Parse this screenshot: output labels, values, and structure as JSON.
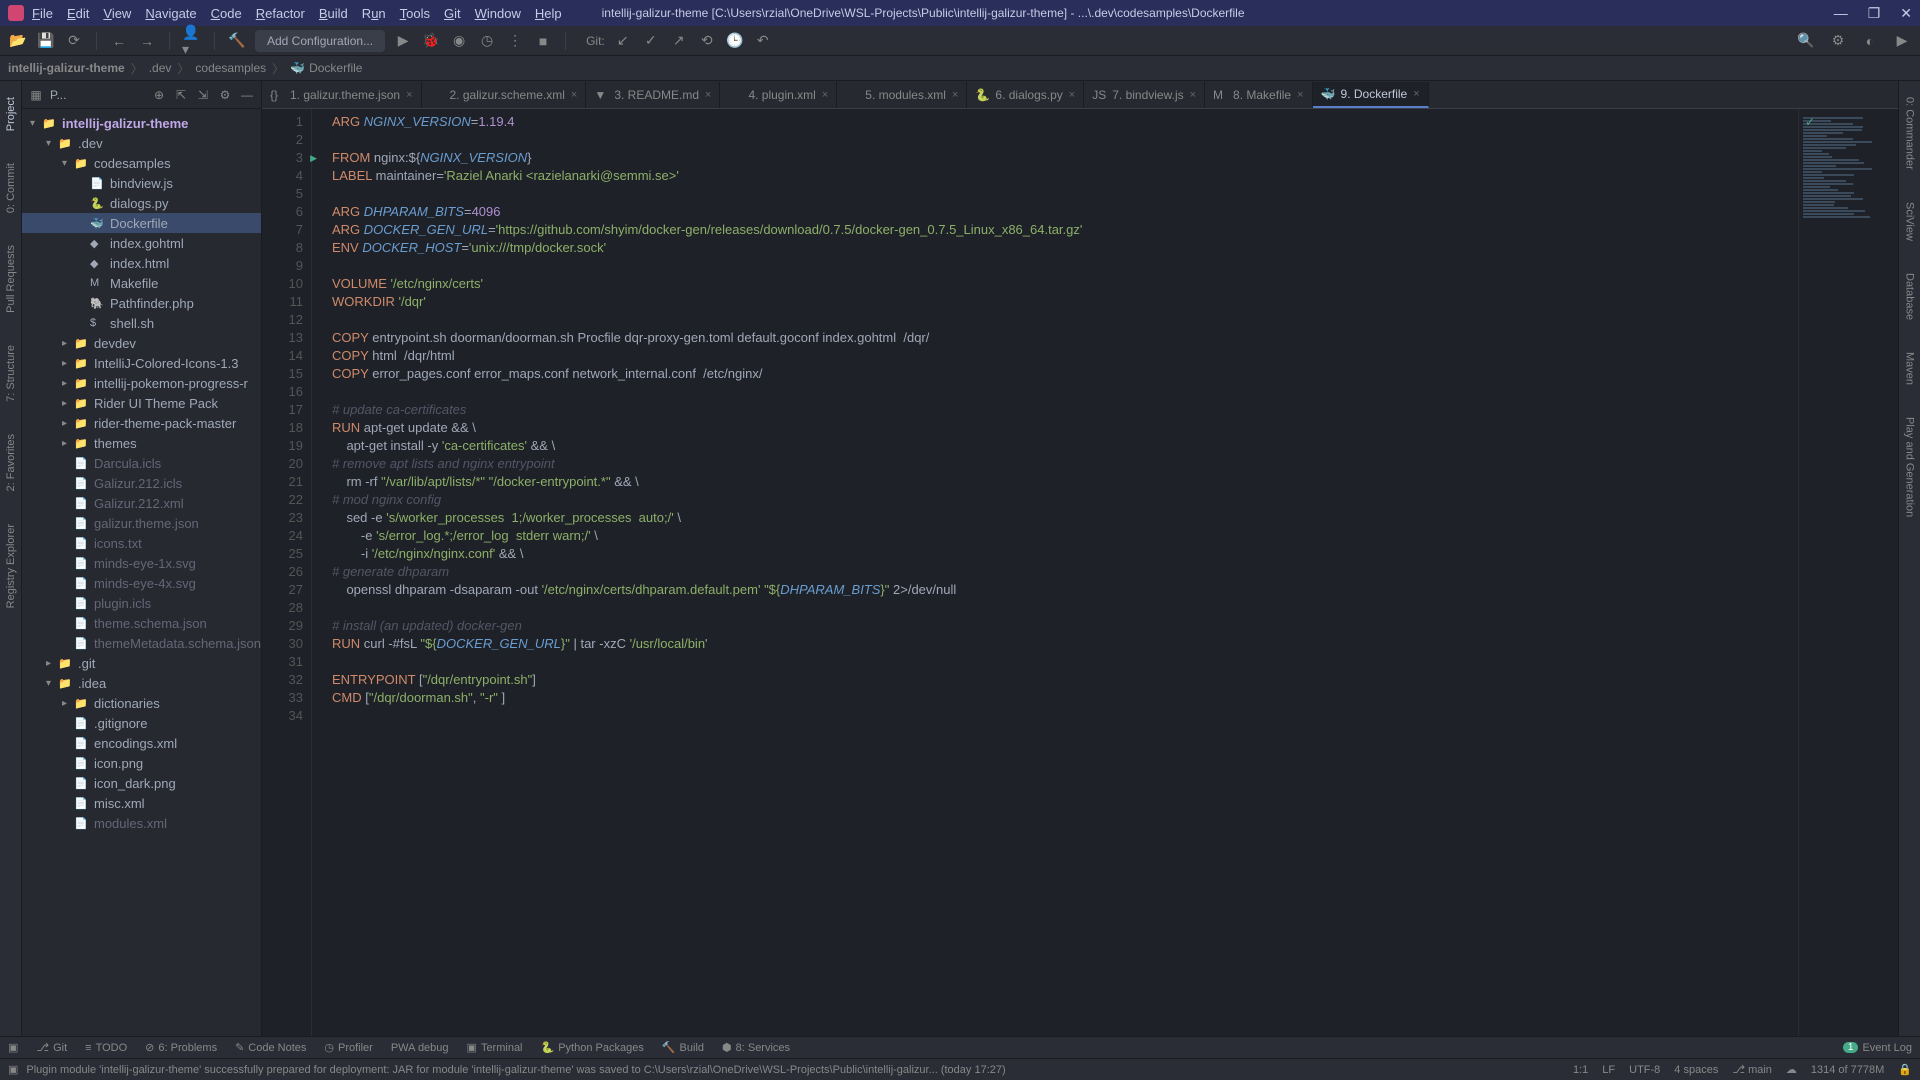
{
  "titlebar": {
    "title": "intellij-galizur-theme [C:\\Users\\rzial\\OneDrive\\WSL-Projects\\Public\\intellij-galizur-theme] - ...\\.dev\\codesamples\\Dockerfile"
  },
  "menus": [
    "File",
    "Edit",
    "View",
    "Navigate",
    "Code",
    "Refactor",
    "Build",
    "Run",
    "Tools",
    "Git",
    "Window",
    "Help"
  ],
  "toolbar": {
    "config": "Add Configuration...",
    "git_label": "Git:"
  },
  "breadcrumbs": [
    "intellij-galizur-theme",
    ".dev",
    "codesamples",
    "Dockerfile"
  ],
  "project": {
    "header": "P...",
    "items": [
      {
        "label": "intellij-galizur-theme",
        "indent": 0,
        "kind": "root",
        "open": true
      },
      {
        "label": ".dev",
        "indent": 1,
        "kind": "folder",
        "open": true
      },
      {
        "label": "codesamples",
        "indent": 2,
        "kind": "folder",
        "open": true
      },
      {
        "label": "bindview.js",
        "indent": 3,
        "kind": "file",
        "icon": "js"
      },
      {
        "label": "dialogs.py",
        "indent": 3,
        "kind": "file",
        "icon": "py"
      },
      {
        "label": "Dockerfile",
        "indent": 3,
        "kind": "file",
        "icon": "docker",
        "selected": true
      },
      {
        "label": "index.gohtml",
        "indent": 3,
        "kind": "file",
        "icon": "html"
      },
      {
        "label": "index.html",
        "indent": 3,
        "kind": "file",
        "icon": "html"
      },
      {
        "label": "Makefile",
        "indent": 3,
        "kind": "file",
        "icon": "make"
      },
      {
        "label": "Pathfinder.php",
        "indent": 3,
        "kind": "file",
        "icon": "php"
      },
      {
        "label": "shell.sh",
        "indent": 3,
        "kind": "file",
        "icon": "sh"
      },
      {
        "label": "devdev",
        "indent": 2,
        "kind": "folder",
        "open": false
      },
      {
        "label": "IntelliJ-Colored-Icons-1.3",
        "indent": 2,
        "kind": "folder",
        "open": false
      },
      {
        "label": "intellij-pokemon-progress-r",
        "indent": 2,
        "kind": "folder",
        "open": false
      },
      {
        "label": "Rider UI Theme Pack",
        "indent": 2,
        "kind": "folder",
        "open": false
      },
      {
        "label": "rider-theme-pack-master",
        "indent": 2,
        "kind": "folder",
        "open": false
      },
      {
        "label": "themes",
        "indent": 2,
        "kind": "folder",
        "open": false
      },
      {
        "label": "Darcula.icls",
        "indent": 2,
        "kind": "file",
        "dim": true
      },
      {
        "label": "Galizur.212.icls",
        "indent": 2,
        "kind": "file",
        "dim": true
      },
      {
        "label": "Galizur.212.xml",
        "indent": 2,
        "kind": "file",
        "dim": true
      },
      {
        "label": "galizur.theme.json",
        "indent": 2,
        "kind": "file",
        "dim": true
      },
      {
        "label": "icons.txt",
        "indent": 2,
        "kind": "file",
        "dim": true
      },
      {
        "label": "minds-eye-1x.svg",
        "indent": 2,
        "kind": "file",
        "dim": true
      },
      {
        "label": "minds-eye-4x.svg",
        "indent": 2,
        "kind": "file",
        "dim": true
      },
      {
        "label": "plugin.icls",
        "indent": 2,
        "kind": "file",
        "dim": true
      },
      {
        "label": "theme.schema.json",
        "indent": 2,
        "kind": "file",
        "dim": true
      },
      {
        "label": "themeMetadata.schema.json",
        "indent": 2,
        "kind": "file",
        "dim": true
      },
      {
        "label": ".git",
        "indent": 1,
        "kind": "folder",
        "open": false,
        "color": "orange"
      },
      {
        "label": ".idea",
        "indent": 1,
        "kind": "folder",
        "open": true,
        "color": "orange"
      },
      {
        "label": "dictionaries",
        "indent": 2,
        "kind": "folder",
        "open": false
      },
      {
        "label": ".gitignore",
        "indent": 2,
        "kind": "file"
      },
      {
        "label": "encodings.xml",
        "indent": 2,
        "kind": "file"
      },
      {
        "label": "icon.png",
        "indent": 2,
        "kind": "file"
      },
      {
        "label": "icon_dark.png",
        "indent": 2,
        "kind": "file"
      },
      {
        "label": "misc.xml",
        "indent": 2,
        "kind": "file"
      },
      {
        "label": "modules.xml",
        "indent": 2,
        "kind": "file",
        "dim": true
      }
    ]
  },
  "tabs": [
    {
      "label": "1. galizur.theme.json",
      "icon": "json"
    },
    {
      "label": "2. galizur.scheme.xml",
      "icon": "xml"
    },
    {
      "label": "3. README.md",
      "icon": "md"
    },
    {
      "label": "4. plugin.xml",
      "icon": "xml"
    },
    {
      "label": "5. modules.xml",
      "icon": "xml"
    },
    {
      "label": "6. dialogs.py",
      "icon": "py"
    },
    {
      "label": "7. bindview.js",
      "icon": "js"
    },
    {
      "label": "8. Makefile",
      "icon": "make"
    },
    {
      "label": "9. Dockerfile",
      "icon": "docker",
      "active": true
    }
  ],
  "left_tabs": [
    "Project",
    "0: Commit",
    "Pull Requests",
    "7: Structure",
    "2: Favorites",
    "Registry Explorer"
  ],
  "right_tabs": [
    "0: Commander",
    "SciView",
    "Database",
    "Maven",
    "Play and Generation"
  ],
  "bottom_tools": [
    "Git",
    "TODO",
    "6: Problems",
    "Code Notes",
    "Profiler",
    "PWA debug",
    "Terminal",
    "Python Packages",
    "Build",
    "8: Services"
  ],
  "event_log": {
    "count": "1",
    "label": "Event Log"
  },
  "status": {
    "msg": "Plugin module 'intellij-galizur-theme' successfully prepared for deployment: JAR for module 'intellij-galizur-theme' was saved to C:\\Users\\rzial\\OneDrive\\WSL-Projects\\Public\\intellij-galizur... (today 17:27)",
    "pos": "1:1",
    "le": "LF",
    "enc": "UTF-8",
    "indent": "4 spaces",
    "branch": "main",
    "mem": "1314 of 7778M"
  },
  "code_lines_count": 34
}
